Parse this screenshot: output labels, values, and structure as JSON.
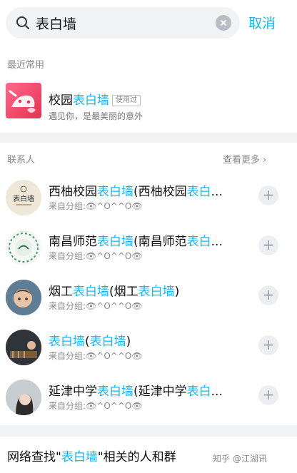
{
  "search": {
    "query": "表白墙",
    "cancel": "取消"
  },
  "recent": {
    "title": "最近常用",
    "item": {
      "name_prefix": "校园",
      "name_hl": "表白墙",
      "badge": "使用过",
      "desc": "遇见你，是最美丽的意外"
    }
  },
  "contacts": {
    "title": "联系人",
    "more": "查看更多 ›",
    "rows": [
      {
        "p1": "西柚校园",
        "h1": "表白墙",
        "p2": "(西柚校园",
        "h2": "表白",
        "tail": "...",
        "group": "来自分组:👁^O^^O👁"
      },
      {
        "p1": "南昌师范",
        "h1": "表白墙",
        "p2": "(南昌师范",
        "h2": "表白",
        "tail": "...",
        "group": "来自分组:👁^O^^O👁"
      },
      {
        "p1": "烟工",
        "h1": "表白墙",
        "p2": "(烟工",
        "h2": "表白墙",
        "tail": ")",
        "group": "来自分组:👁^O^^O👁"
      },
      {
        "p1": "",
        "h1": "表白墙",
        "p2": "(",
        "h2": "表白墙",
        "tail": ")",
        "group": "来自分组:👁^O^^O👁"
      },
      {
        "p1": "延津中学",
        "h1": "表白墙",
        "p2": "(延津中学",
        "h2": "表白",
        "tail": "...",
        "group": "来自分组:👁^O^^O👁"
      }
    ],
    "avatar_text_1": "表白墙"
  },
  "network": {
    "prefix": "网络查找\"",
    "hl": "表白墙",
    "suffix": "\"相关的人和群"
  },
  "watermark": "知乎 @江湖讯",
  "colors": {
    "accent": "#12b7f5",
    "gap": "#f2f3f5"
  }
}
